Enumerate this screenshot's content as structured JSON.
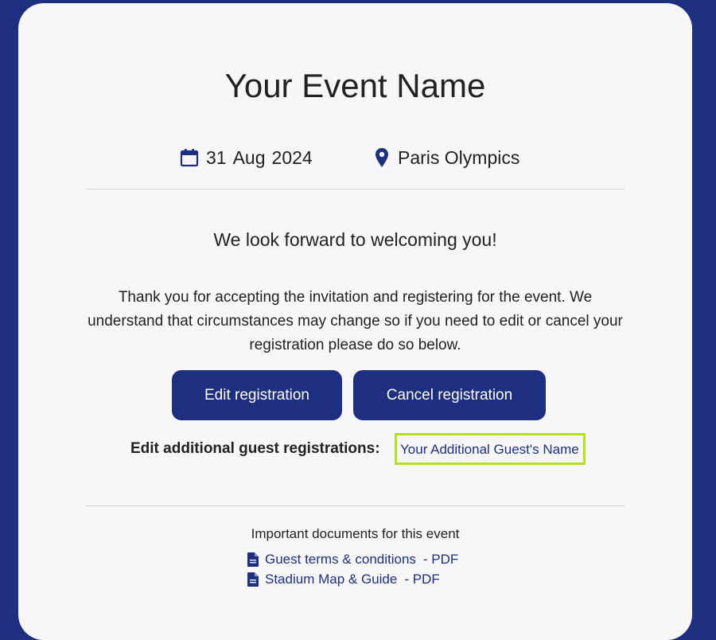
{
  "event": {
    "title": "Your Event Name",
    "date_day": "31",
    "date_month": "Aug",
    "date_year": "2024",
    "location": "Paris Olympics"
  },
  "message": {
    "heading": "We look forward to welcoming you!",
    "body": "Thank you for accepting the invitation and registering for the event. We understand that circumstances may change so if you need to edit or cancel your registration please do so below."
  },
  "actions": {
    "edit_label": "Edit registration",
    "cancel_label": "Cancel registration"
  },
  "guests": {
    "label": "Edit additional guest registrations:",
    "link_text": "Your Additional Guest's Name"
  },
  "documents": {
    "heading": "Important documents for this event",
    "items": [
      {
        "name": "Guest terms & conditions",
        "format": "- PDF"
      },
      {
        "name": "Stadium Map & Guide",
        "format": "- PDF"
      }
    ]
  },
  "colors": {
    "brand": "#1e2f7f",
    "highlight": "#b5e026",
    "card": "#f7f7fa"
  },
  "icons": [
    "calendar-icon",
    "location-pin-icon",
    "document-icon"
  ]
}
